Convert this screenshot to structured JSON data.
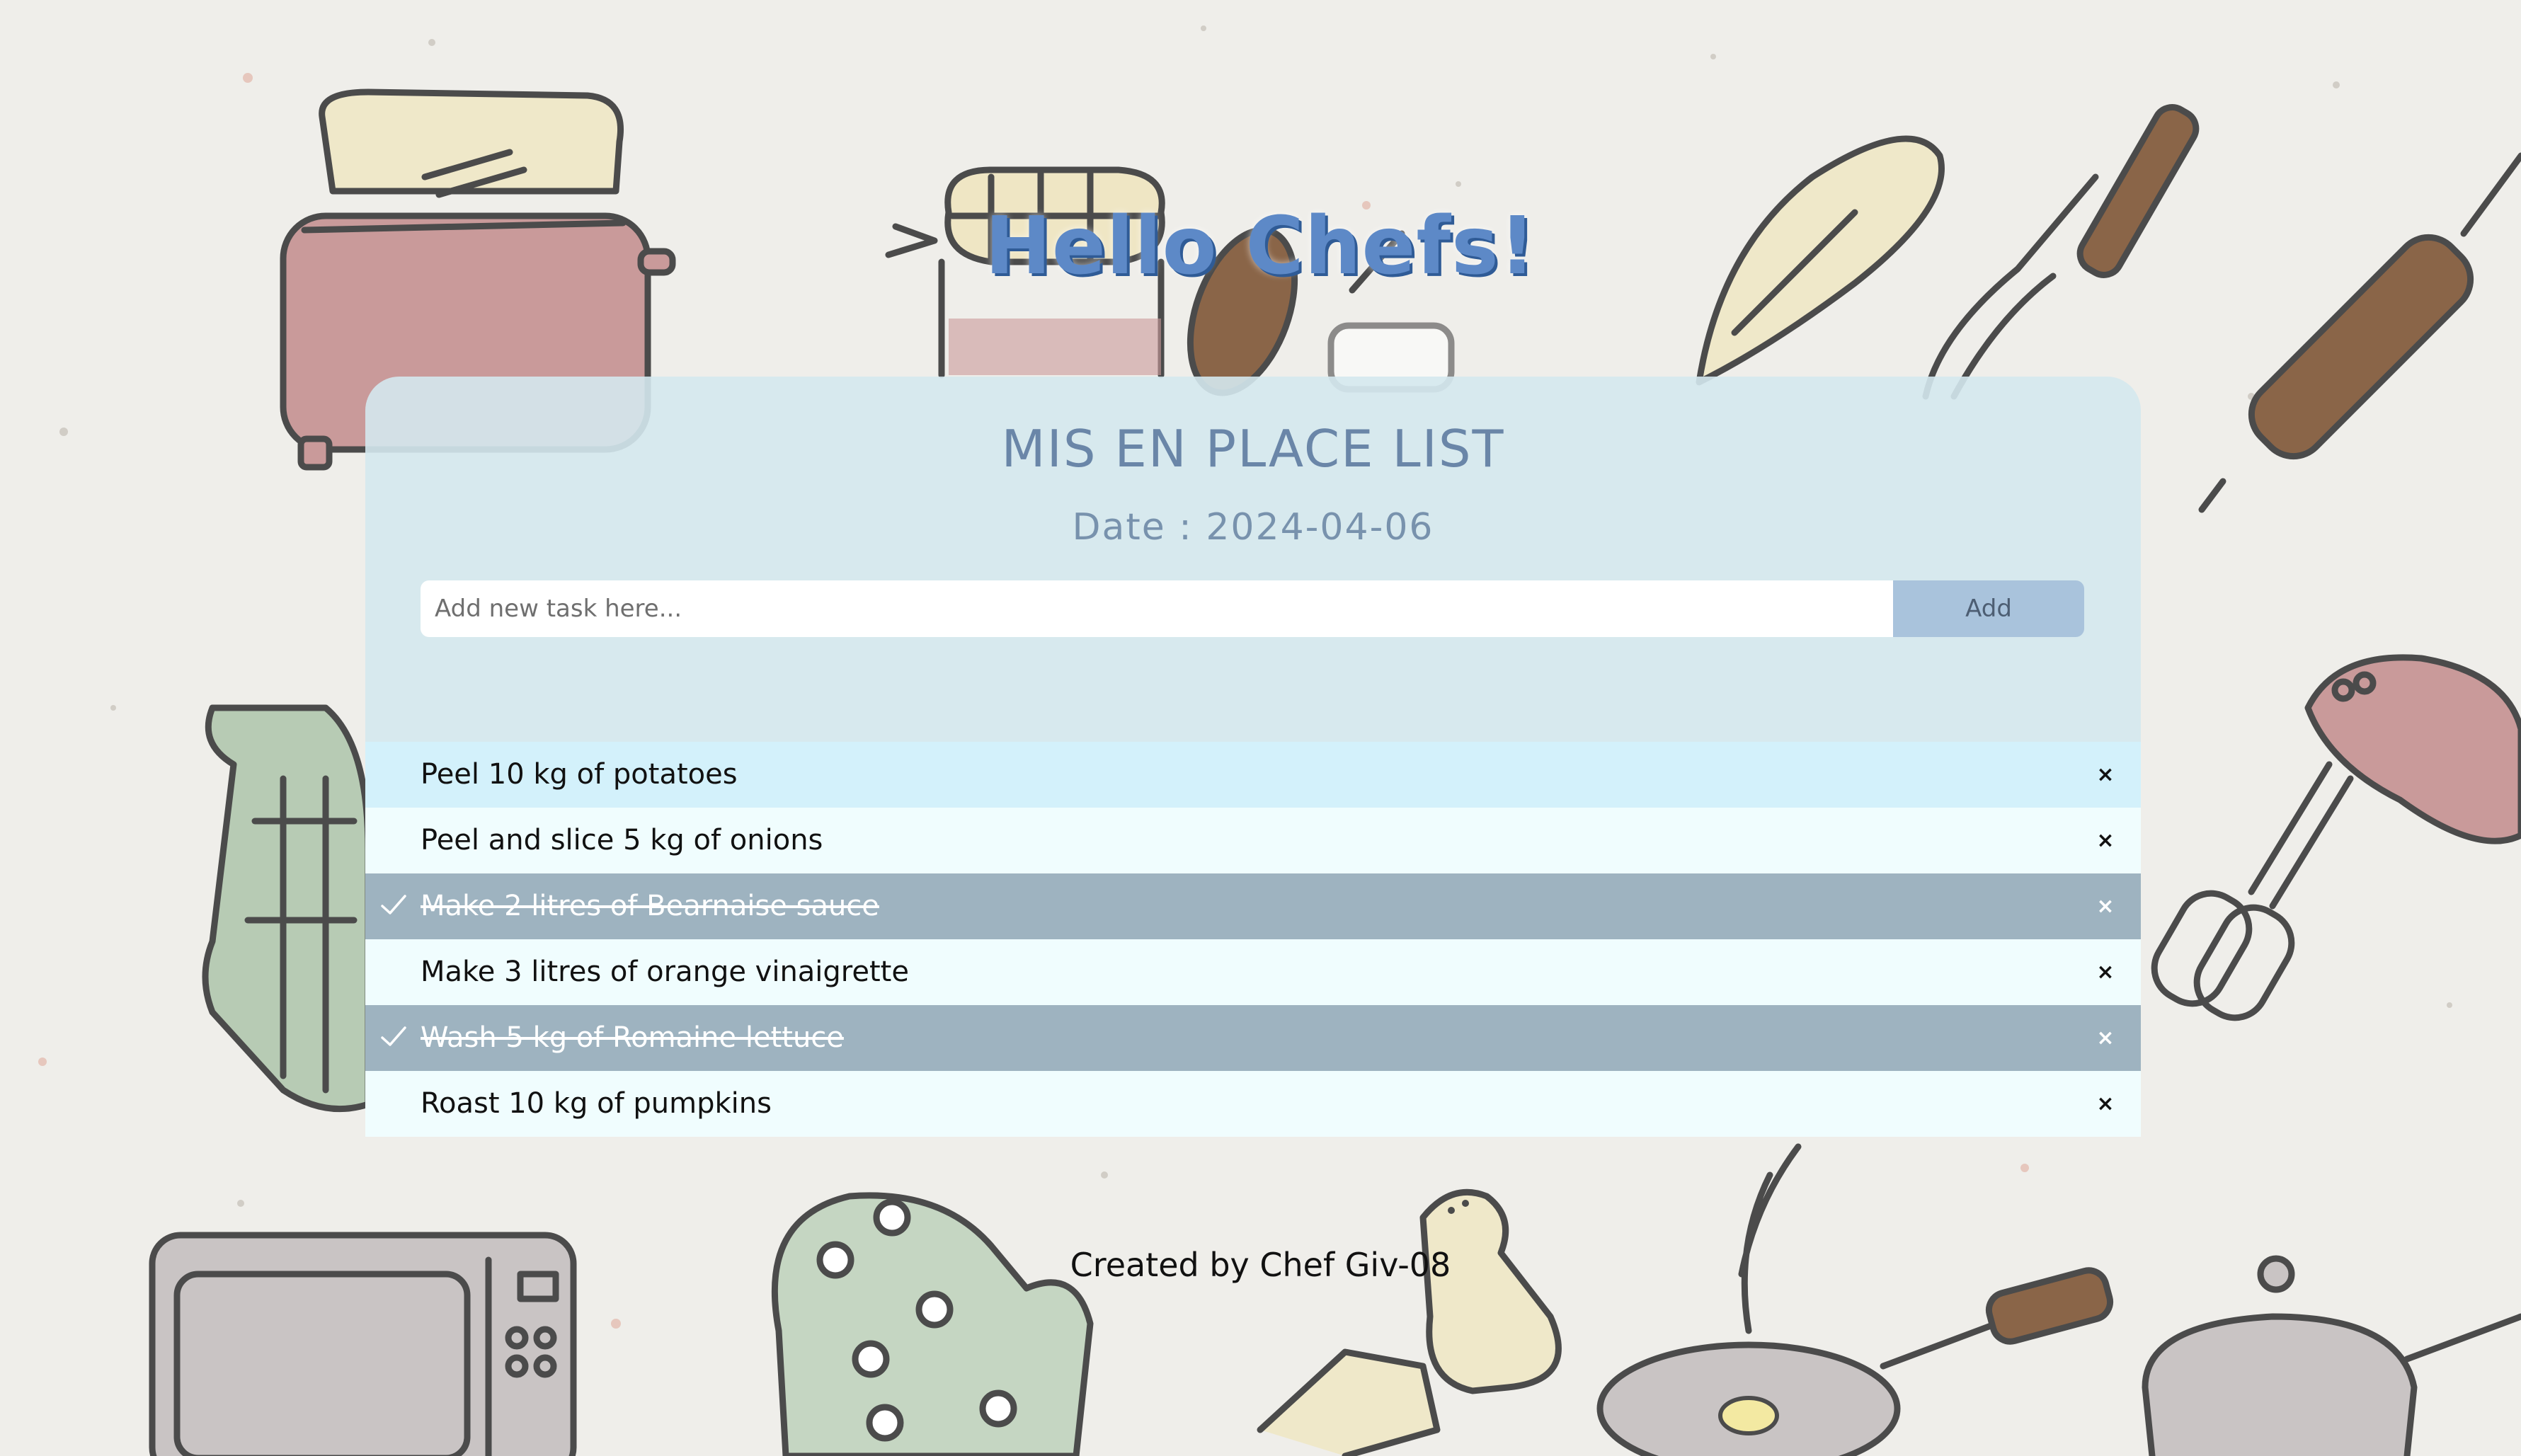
{
  "header": {
    "greeting": "Hello Chefs!"
  },
  "card": {
    "title": "MIS EN PLACE LIST",
    "date_label": "Date : 2024-04-06"
  },
  "new_task": {
    "placeholder": "Add new task here...",
    "value": "",
    "add_label": "Add"
  },
  "tasks": [
    {
      "text": "Peel 10 kg of potatoes",
      "done": false,
      "state": "hover",
      "remove": "×"
    },
    {
      "text": "Peel and slice 5 kg of onions",
      "done": false,
      "state": "normal",
      "remove": "×"
    },
    {
      "text": "Make 2 litres of Bearnaise sauce",
      "done": true,
      "state": "checked",
      "remove": "×"
    },
    {
      "text": "Make 3 litres of orange vinaigrette",
      "done": false,
      "state": "normal",
      "remove": "×"
    },
    {
      "text": "Wash 5 kg of Romaine lettuce",
      "done": true,
      "state": "checked",
      "remove": "×"
    },
    {
      "text": "Roast 10 kg of pumpkins",
      "done": false,
      "state": "normal",
      "remove": "×"
    }
  ],
  "footer": {
    "credit": "Created by Chef Giv-08"
  },
  "colors": {
    "page_bg": "#efeeea",
    "title": "#5d89c7",
    "card_bg": "#d4e8ee",
    "add_button": "#a9c3dc",
    "row_hover": "#d3f1fb",
    "row_normal": "#f0fdfe",
    "row_checked": "#9eb3c0"
  },
  "background_icons": [
    "toaster-icon",
    "jam-jar-icon",
    "whisk-icon",
    "rolling-pin-icon",
    "oven-mitt-icon",
    "hand-mixer-icon",
    "microwave-icon",
    "salt-shaker-icon",
    "frying-pan-icon",
    "cooking-pot-icon",
    "butter-icon",
    "spatula-icon"
  ]
}
